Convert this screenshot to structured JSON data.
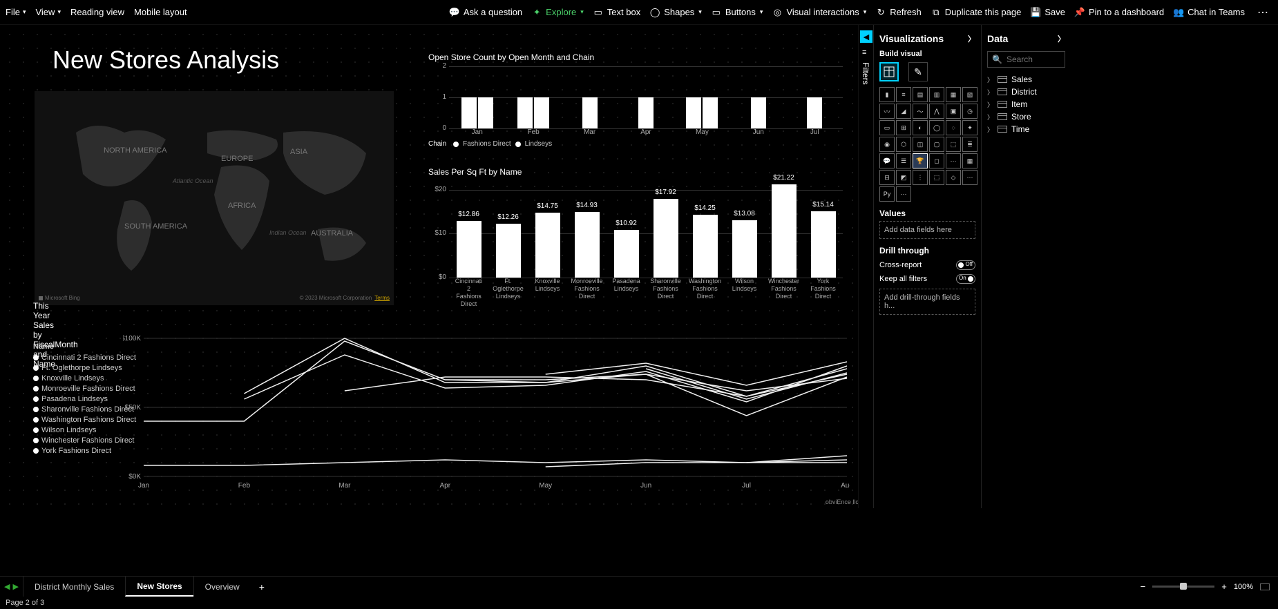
{
  "ribbon": {
    "file": "File",
    "view": "View",
    "reading_view": "Reading view",
    "mobile_layout": "Mobile layout",
    "ask": "Ask a question",
    "explore": "Explore",
    "textbox": "Text box",
    "shapes": "Shapes",
    "buttons": "Buttons",
    "visual_interactions": "Visual interactions",
    "refresh": "Refresh",
    "duplicate": "Duplicate this page",
    "save": "Save",
    "pin": "Pin to a dashboard",
    "chat": "Chat in Teams"
  },
  "filters_tab_label": "Filters",
  "page_title": "New Stores Analysis",
  "map": {
    "regions": [
      "NORTH AMERICA",
      "EUROPE",
      "ASIA",
      "SOUTH AMERICA",
      "AFRICA",
      "AUSTRALIA"
    ],
    "oceans": [
      "Atlantic Ocean",
      "Indian Ocean"
    ],
    "bing": "Microsoft Bing",
    "credit": "© 2023 Microsoft Corporation",
    "terms": "Terms"
  },
  "chart_data": [
    {
      "type": "bar",
      "title": "Open Store Count by Open Month and Chain",
      "categories": [
        "Jan",
        "Feb",
        "Mar",
        "Apr",
        "May",
        "Jun",
        "Jul"
      ],
      "series": [
        {
          "name": "Fashions Direct",
          "values": [
            1,
            1,
            1,
            1,
            1,
            1,
            1
          ]
        },
        {
          "name": "Lindseys",
          "values": [
            1,
            1,
            0,
            0,
            1,
            0,
            0
          ]
        }
      ],
      "legend_title": "Chain",
      "ylabel": "",
      "ylim": [
        0,
        2
      ],
      "y_ticks": [
        0,
        1,
        2
      ]
    },
    {
      "type": "bar",
      "title": "Sales Per Sq Ft by Name",
      "categories": [
        "Cincinnati 2 Fashions Direct",
        "Ft. Oglethorpe Lindseys",
        "Knoxville Lindseys",
        "Monroeville Fashions Direct",
        "Pasadena Lindseys",
        "Sharonville Fashions Direct",
        "Washington Fashions Direct",
        "Wilson Lindseys",
        "Winchester Fashions Direct",
        "York Fashions Direct"
      ],
      "values": [
        12.86,
        12.26,
        14.75,
        14.93,
        10.92,
        17.92,
        14.25,
        13.08,
        21.22,
        15.14
      ],
      "data_labels": [
        "$12.86",
        "$12.26",
        "$14.75",
        "$14.93",
        "$10.92",
        "$17.92",
        "$14.25",
        "$13.08",
        "$21.22",
        "$15.14"
      ],
      "ylabel": "",
      "ylim": [
        0,
        22
      ],
      "y_ticks": [
        0,
        10,
        20
      ],
      "y_tick_labels": [
        "$0",
        "$10",
        "$20"
      ]
    },
    {
      "type": "line",
      "title": "This Year Sales by FiscalMonth and Name",
      "x": [
        "Jan",
        "Feb",
        "Mar",
        "Apr",
        "May",
        "Jun",
        "Jul",
        "Aug"
      ],
      "y_ticks": [
        0,
        50,
        100
      ],
      "y_tick_labels": [
        "$0K",
        "$50K",
        "$100K"
      ],
      "legend_header": "Name",
      "series": [
        {
          "name": "Cincinnati 2 Fashions Direct",
          "y": [
            null,
            null,
            62,
            72,
            72,
            70,
            58,
            74
          ]
        },
        {
          "name": "Ft. Oglethorpe Lindseys",
          "y": [
            null,
            56,
            88,
            64,
            66,
            76,
            54,
            80
          ]
        },
        {
          "name": "Knoxville Lindseys",
          "y": [
            null,
            null,
            null,
            null,
            74,
            82,
            66,
            83
          ]
        },
        {
          "name": "Monroeville Fashions Direct",
          "y": [
            null,
            null,
            null,
            null,
            null,
            78,
            56,
            75
          ]
        },
        {
          "name": "Pasadena Lindseys",
          "y": [
            null,
            60,
            100,
            68,
            68,
            74,
            62,
            71
          ]
        },
        {
          "name": "Sharonville Fashions Direct",
          "y": [
            40,
            40,
            98,
            70,
            68,
            80,
            58,
            78
          ]
        },
        {
          "name": "Washington Fashions Direct",
          "y": [
            null,
            null,
            null,
            null,
            7,
            10,
            10,
            15
          ]
        },
        {
          "name": "Wilson Lindseys",
          "y": [
            8,
            8,
            10,
            12,
            10,
            12,
            10,
            12
          ]
        },
        {
          "name": "Winchester Fashions Direct",
          "y": [
            null,
            null,
            null,
            null,
            null,
            null,
            10,
            10
          ]
        },
        {
          "name": "York Fashions Direct",
          "y": [
            null,
            null,
            null,
            70,
            70,
            74,
            44,
            72
          ]
        }
      ]
    }
  ],
  "watermark": "obviEnce llc ©",
  "viz": {
    "pane_title": "Visualizations",
    "build_visual": "Build visual",
    "values": "Values",
    "add_fields": "Add data fields here",
    "drill_through": "Drill through",
    "cross_report": "Cross-report",
    "off": "Off",
    "keep_filters": "Keep all filters",
    "on": "On",
    "add_drill": "Add drill-through fields h..."
  },
  "data": {
    "pane_title": "Data",
    "search_placeholder": "Search",
    "tables": [
      "Sales",
      "District",
      "Item",
      "Store",
      "Time"
    ]
  },
  "pages": {
    "tabs": [
      "District Monthly Sales",
      "New Stores",
      "Overview"
    ],
    "active_index": 1,
    "zoom": "100%",
    "status": "Page 2 of 3"
  }
}
